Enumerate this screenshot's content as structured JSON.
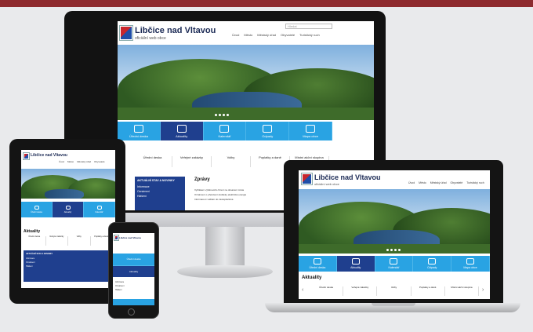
{
  "site": {
    "title": "Libčice nad Vltavou",
    "subtitle": "oficiální web obce",
    "nav": [
      "Úvod",
      "Město",
      "Městský úřad",
      "Obyvatelé",
      "Turistický ruch",
      "Kontakt"
    ],
    "search_placeholder": "Hledat",
    "tiles": [
      "Úřední deska",
      "Aktuality",
      "Kalendář",
      "Odpady",
      "Mapa obce"
    ],
    "subnav": [
      "Úřední deska",
      "Veřejné zakázky",
      "Volby",
      "Poplatky a daně",
      "Místní akční skupina",
      "Kontakty na úřad"
    ],
    "section_heading": "Aktuality",
    "news_heading": "Zprávy",
    "panel_title": "AKTUÁLNÍ STAV A NOVINKY",
    "panel_items": [
      "Informace",
      "Oznámení",
      "Hlášení"
    ],
    "news_items": [
      "Vyhlášení výběrového řízení na obsazení místa",
      "Oznámení o přerušení dodávky elektrické energie",
      "Informace k volbám do zastupitelstva"
    ]
  }
}
